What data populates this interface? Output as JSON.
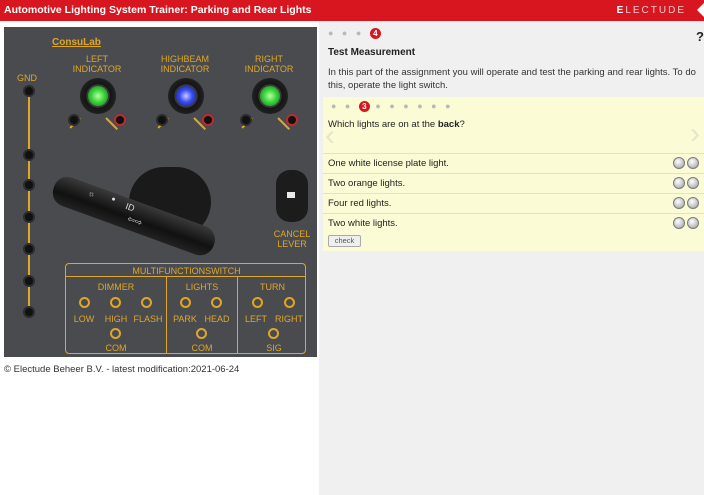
{
  "app": {
    "title": "Automotive Lighting System Trainer: Parking and Rear Lights",
    "brand_first": "E",
    "brand_rest": "LECTUDE"
  },
  "trainer": {
    "logo": "ConsuLab",
    "gnd": "GND",
    "indicators": [
      {
        "line1": "LEFT",
        "line2": "INDICATOR",
        "color": "#3bd33f"
      },
      {
        "line1": "HIGHBEAM",
        "line2": "INDICATOR",
        "color": "#3a4bf0"
      },
      {
        "line1": "RIGHT",
        "line2": "INDICATOR",
        "color": "#3bd33f"
      }
    ],
    "cancel_lever": {
      "line1": "CANCEL",
      "line2": "LEVER"
    },
    "mfs": {
      "title": "MULTIFUNCTIONSWITCH",
      "dimmer": "DIMMER",
      "lights": "LIGHTS",
      "turn": "TURN",
      "low": "LOW",
      "high": "HIGH",
      "flash": "FLASH",
      "park": "PARK",
      "head": "HEAD",
      "left": "LEFT",
      "right": "RIGHT",
      "com1": "COM",
      "com2": "COM",
      "sig": "SIG"
    }
  },
  "footer": {
    "copyright": "© Electude Beheer B.V. - latest modification:2021-06-24"
  },
  "assignment": {
    "step_dots": "● ● ●",
    "step_active": "4",
    "help": "?",
    "section_title": "Test Measurement",
    "section_text": "In this part of the assignment you will operate and test the parking and rear lights. To do this, operate the light switch.",
    "question_dots_before": "● ●",
    "question_active": "3",
    "question_dots_after": "● ● ● ● ● ●",
    "question_prefix": "Which lights are on at the ",
    "question_bold": "back",
    "question_suffix": "?",
    "answers": [
      "One white license plate light.",
      "Two orange lights.",
      "Four red lights.",
      "Two white lights."
    ],
    "check_label": "check"
  }
}
